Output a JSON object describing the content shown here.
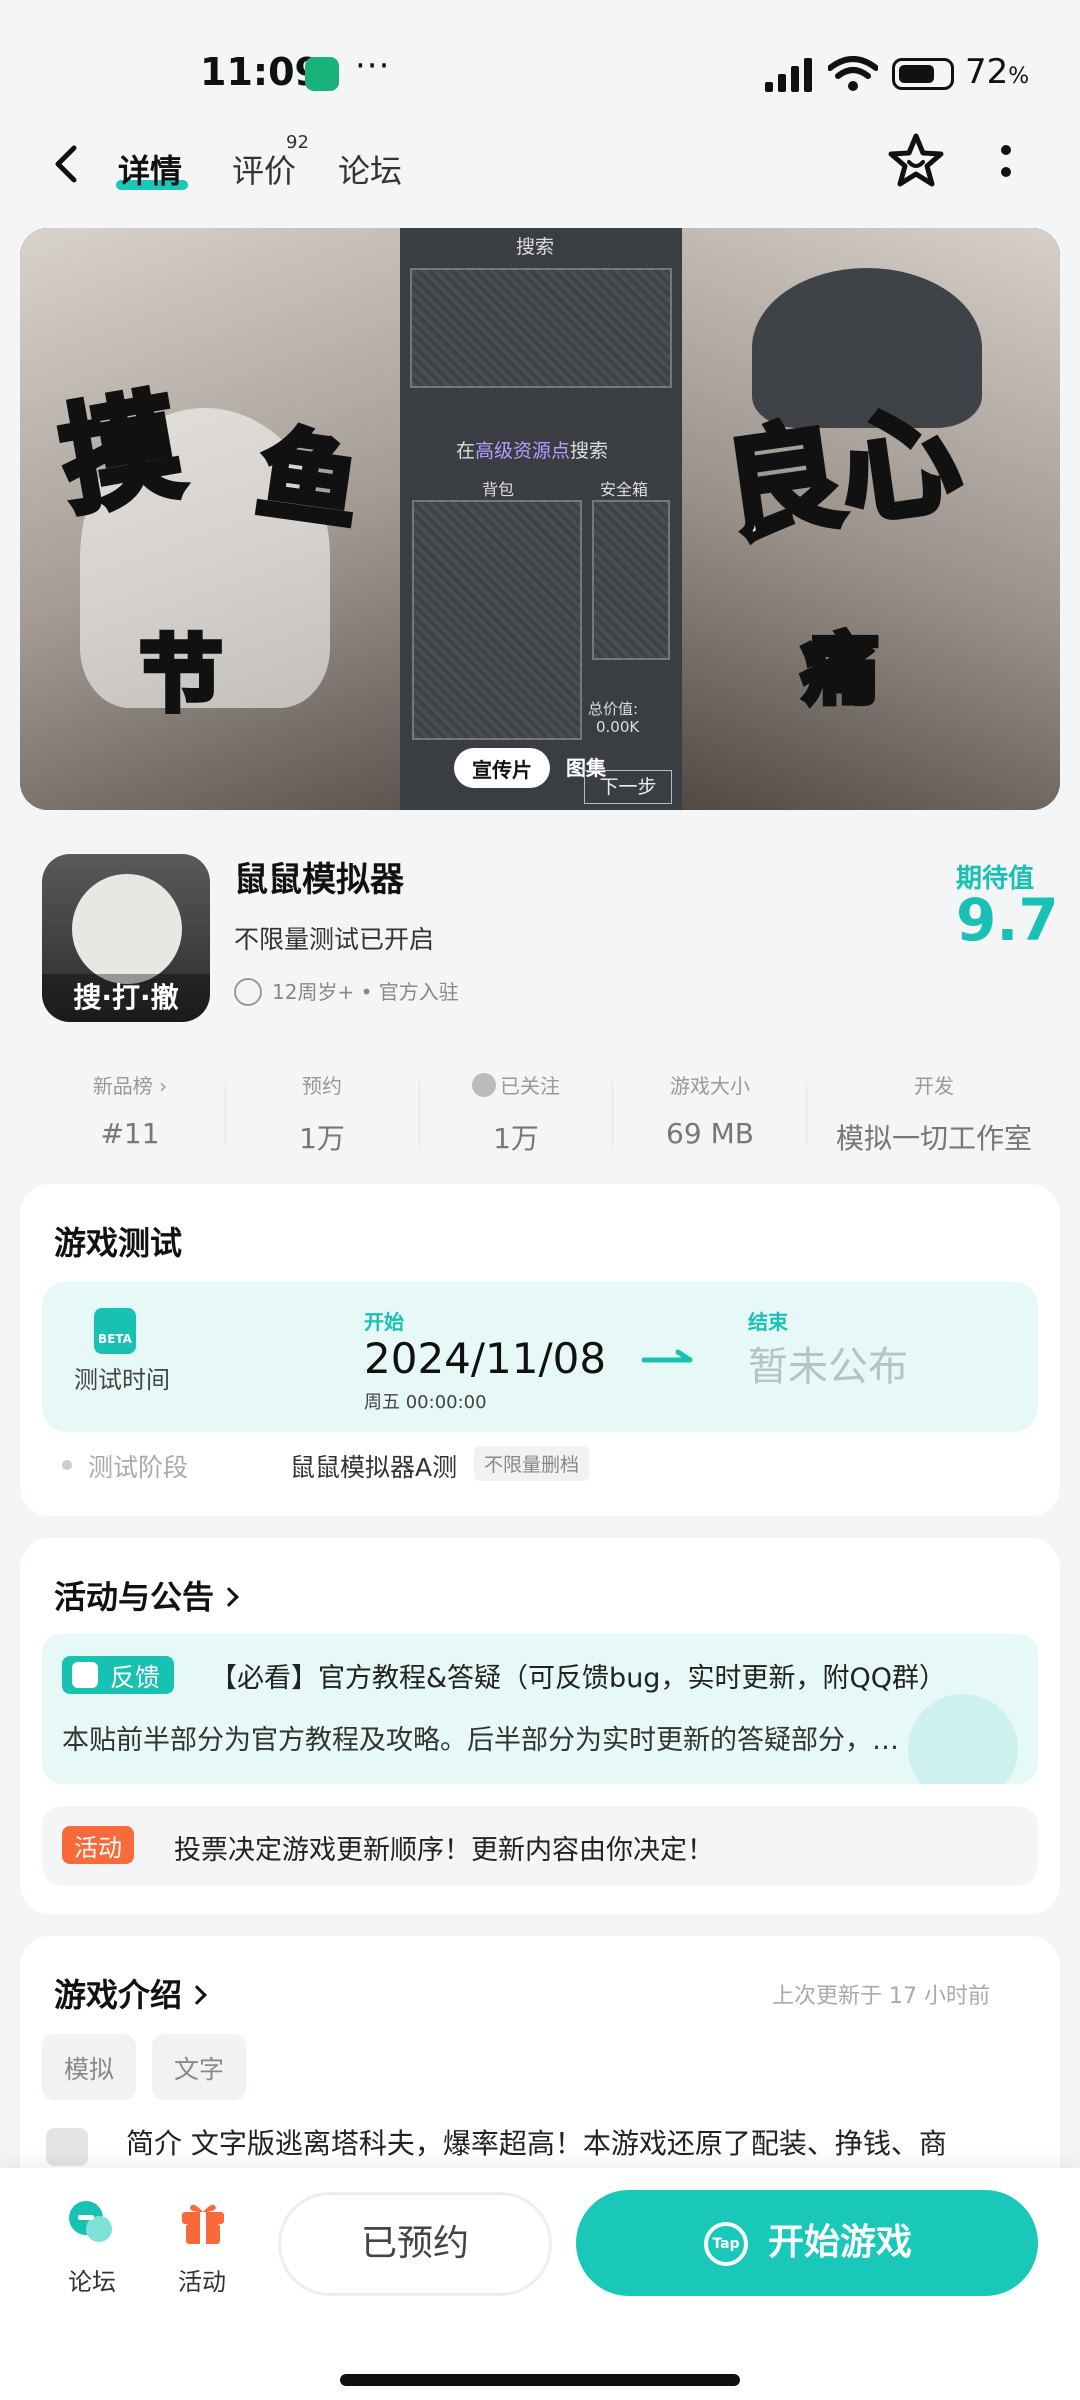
{
  "status_bar": {
    "time": "11:09",
    "more": "···",
    "battery_percent": "72",
    "battery_level": 0.72,
    "battery_suffix": "%"
  },
  "nav": {
    "tabs": [
      {
        "label": "详情",
        "active": true
      },
      {
        "label": "评价",
        "badge": "92"
      },
      {
        "label": "论坛"
      }
    ]
  },
  "hero": {
    "left_text_big": "摸",
    "left_text_big2": "鱼",
    "left_text_small": "节",
    "right_text_big": "良心",
    "right_text_small": "痛",
    "mid_title": "搜索",
    "mid_search_prefix": "在",
    "mid_search_link": "高级资源点",
    "mid_search_suffix": "搜索",
    "mid_backpack": "背包",
    "mid_safe": "安全箱",
    "mid_total_label": "总价值:",
    "mid_total_value": "0.00K",
    "pill_promo": "宣传片",
    "pill_gallery": "图集",
    "next_step": "下一步"
  },
  "app": {
    "icon_badge": "搜·打·撤",
    "title": "鼠鼠模拟器",
    "subtitle": "不限量测试已开启",
    "meta": "12周岁+ • 官方入驻",
    "expect_label": "期待值",
    "expect_value": "9.7"
  },
  "stats": [
    {
      "label": "新品榜",
      "value": "#11"
    },
    {
      "label": "预约",
      "value": "1万"
    },
    {
      "label": "已关注",
      "value": "1万"
    },
    {
      "label": "游戏大小",
      "value": "69 MB"
    },
    {
      "label": "开发",
      "value": "模拟一切工作室"
    }
  ],
  "test": {
    "title": "游戏测试",
    "beta": "BETA",
    "time_label": "测试时间",
    "start_label": "开始",
    "start_date": "2024/11/08",
    "start_sub": "周五  00:00:00",
    "end_label": "结束",
    "end_value": "暂未公布",
    "stage_label": "测试阶段",
    "stage_value": "鼠鼠模拟器A测",
    "stage_tag": "不限量删档"
  },
  "news": {
    "title": "活动与公告",
    "item1_tag": "反馈",
    "item1_headline": "【必看】官方教程&答疑（可反馈bug，实时更新，附QQ群）",
    "item1_body": "本贴前半部分为官方教程及攻略。后半部分为实时更新的答疑部分，…",
    "item2_tag": "活动",
    "item2_text": "投票决定游戏更新顺序！更新内容由你决定！"
  },
  "intro": {
    "title": "游戏介绍",
    "updated": "上次更新于 17 小时前",
    "chips": [
      "模拟",
      "文字"
    ],
    "text": "简介  文字版逃离塔科夫，爆率超高！本游戏还原了配装、挣钱、商"
  },
  "bottom": {
    "forum": "论坛",
    "activity": "活动",
    "reserved": "已预约",
    "tap": "Tap",
    "start": "开始游戏"
  },
  "colors": {
    "accent": "#19c8b9",
    "activity_tag": "#f86a3a"
  }
}
